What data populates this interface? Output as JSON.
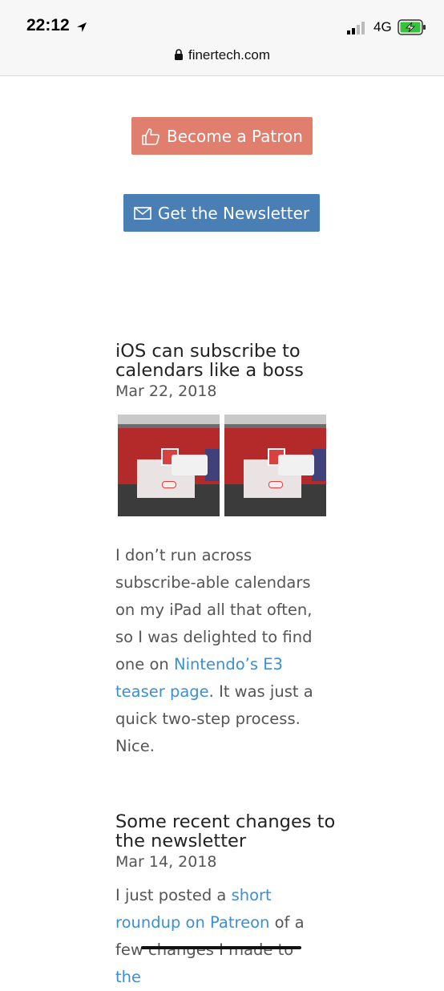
{
  "status_bar": {
    "time": "22:12",
    "network": "4G",
    "icons": [
      "location-arrow-icon",
      "signal-bars-icon",
      "battery-charging-icon"
    ]
  },
  "browser": {
    "url": "finertech.com",
    "icon": "lock-icon"
  },
  "buttons": {
    "patron_label": "Become a Patron",
    "newsletter_label": "Get the Newsletter",
    "colors": {
      "patron": "#e07f6e",
      "newsletter": "#4a7fb5"
    }
  },
  "posts": [
    {
      "title": "iOS can subscribe to calendars like a boss",
      "date": "Mar 22, 2018",
      "body": {
        "text1": "I don’t run across subscribe-able calendars on my iPad all that often, so I was delighted to find one on ",
        "link": "Nintendo’s E3 teaser page",
        "text2": ". It was just a quick two-step process. Nice."
      }
    },
    {
      "title": "Some recent changes to the newsletter",
      "date": "Mar 14, 2018",
      "body": {
        "text1": "I just posted a ",
        "link1": "short roundup on Patreon",
        "text2": " of a few changes I made to ",
        "link2": "the"
      }
    }
  ],
  "link_color": "#3a8fd6"
}
